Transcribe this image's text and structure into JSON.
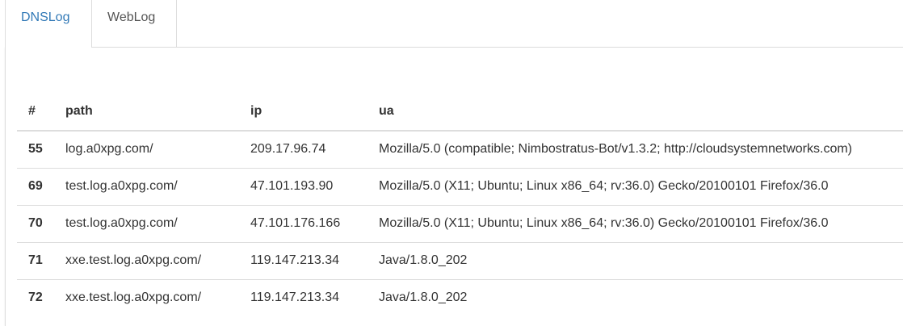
{
  "tabs": [
    {
      "label": "DNSLog",
      "active": true
    },
    {
      "label": "WebLog",
      "active": false
    }
  ],
  "table": {
    "columns": [
      "#",
      "path",
      "ip",
      "ua"
    ],
    "rows": [
      {
        "id": "55",
        "path": "log.a0xpg.com/",
        "ip": "209.17.96.74",
        "ua": "Mozilla/5.0 (compatible; Nimbostratus-Bot/v1.3.2; http://cloudsystemnetworks.com)"
      },
      {
        "id": "69",
        "path": "test.log.a0xpg.com/",
        "ip": "47.101.193.90",
        "ua": "Mozilla/5.0 (X11; Ubuntu; Linux x86_64; rv:36.0) Gecko/20100101 Firefox/36.0"
      },
      {
        "id": "70",
        "path": "test.log.a0xpg.com/",
        "ip": "47.101.176.166",
        "ua": "Mozilla/5.0 (X11; Ubuntu; Linux x86_64; rv:36.0) Gecko/20100101 Firefox/36.0"
      },
      {
        "id": "71",
        "path": "xxe.test.log.a0xpg.com/",
        "ip": "119.147.213.34",
        "ua": "Java/1.8.0_202"
      },
      {
        "id": "72",
        "path": "xxe.test.log.a0xpg.com/",
        "ip": "119.147.213.34",
        "ua": "Java/1.8.0_202"
      }
    ]
  },
  "colors": {
    "active_tab": "#337ab7",
    "text": "#333333",
    "border": "#dddddd"
  }
}
